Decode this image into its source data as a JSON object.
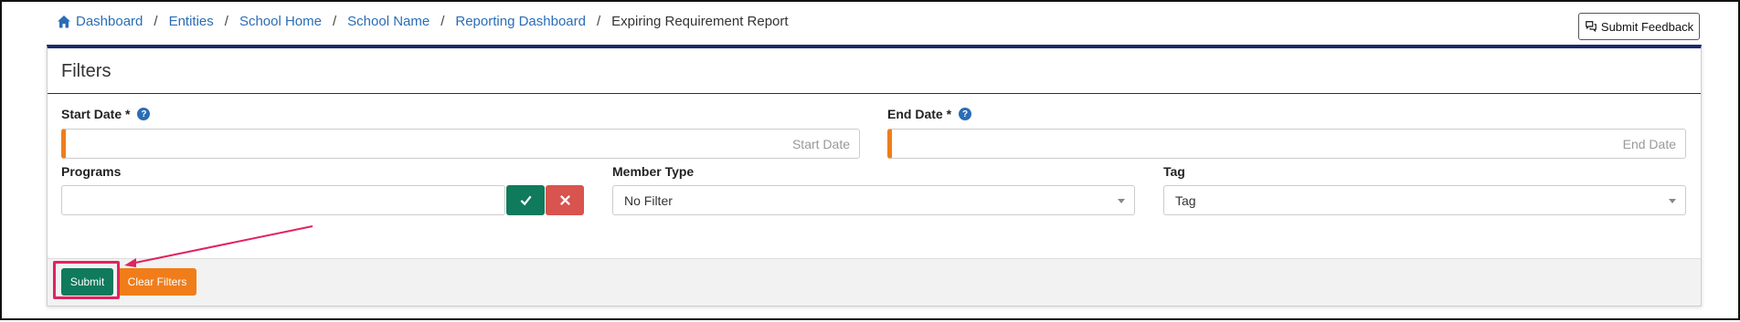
{
  "breadcrumb": {
    "items": [
      "Dashboard",
      "Entities",
      "School Home",
      "School Name",
      "Reporting Dashboard"
    ],
    "current": "Expiring Requirement Report",
    "separator": "/"
  },
  "feedback_button": {
    "label": "Submit Feedback",
    "icon": "chat-bubbles-icon"
  },
  "filters": {
    "title": "Filters",
    "start_date": {
      "label": "Start Date *",
      "placeholder": "Start Date",
      "value": ""
    },
    "end_date": {
      "label": "End Date *",
      "placeholder": "End Date",
      "value": ""
    },
    "programs": {
      "label": "Programs",
      "value": ""
    },
    "member_type": {
      "label": "Member Type",
      "selected": "No Filter"
    },
    "tag": {
      "label": "Tag",
      "selected": "Tag"
    },
    "help_symbol": "?"
  },
  "footer": {
    "submit_label": "Submit",
    "clear_label": "Clear Filters"
  },
  "colors": {
    "accent_navy": "#1c2a6b",
    "link_blue": "#2a6db5",
    "submit_green": "#0f7a5c",
    "clear_orange": "#f07d1a",
    "cancel_red": "#d9534f",
    "annotation_pink": "#e0245e"
  }
}
